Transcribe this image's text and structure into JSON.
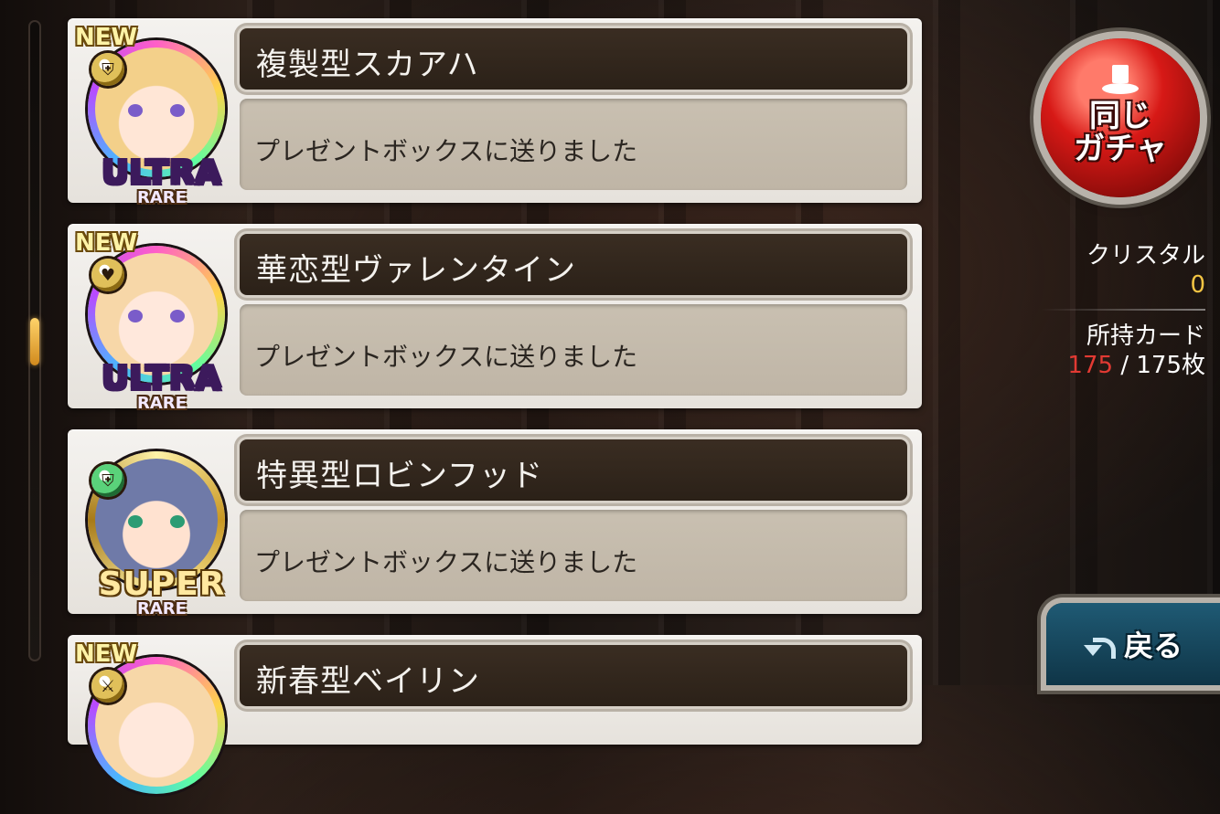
{
  "results": {
    "items": [
      {
        "new_badge": "NEW",
        "rarity_top": "ULTRA",
        "rarity_bottom": "RARE",
        "name": "複製型スカアハ",
        "message": "プレゼントボックスに送りました",
        "type_icon": "shield-icon",
        "ring": "rainbow",
        "palette": "blonde"
      },
      {
        "new_badge": "NEW",
        "rarity_top": "ULTRA",
        "rarity_bottom": "RARE",
        "name": "華恋型ヴァレンタイン",
        "message": "プレゼントボックスに送りました",
        "type_icon": "heart-icon",
        "ring": "rainbow",
        "palette": "pink"
      },
      {
        "new_badge": "",
        "rarity_top": "SUPER",
        "rarity_bottom": "RARE",
        "name": "特異型ロビンフッド",
        "message": "プレゼントボックスに送りました",
        "type_icon": "shield-icon",
        "ring": "gold",
        "palette": "blue"
      },
      {
        "new_badge": "NEW",
        "rarity_top": "",
        "rarity_bottom": "",
        "name": "新春型ベイリン",
        "message": "",
        "type_icon": "sword-icon",
        "ring": "rainbow",
        "palette": "pink"
      }
    ]
  },
  "sidebar": {
    "same_gacha_button": {
      "line1": "同じ",
      "line2": "ガチャ"
    },
    "crystal_label": "クリスタル",
    "crystal_value": "0",
    "cards_label": "所持カード",
    "cards_current": "175",
    "cards_separator": " / ",
    "cards_total": "175枚",
    "back_button_label": "戻る"
  },
  "colors": {
    "accent_red": "#d71916",
    "crystal_gold": "#f2c443",
    "cards_red": "#e23a33",
    "back_teal": "#1f5a74"
  }
}
